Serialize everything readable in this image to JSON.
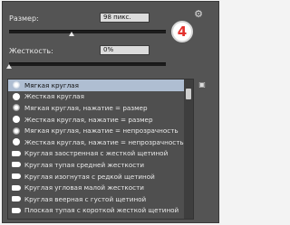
{
  "size": {
    "label": "Размер:",
    "value": "98 пикс.",
    "slider_value": 0.4
  },
  "hardness": {
    "label": "Жесткость:",
    "value": "0%",
    "slider_value": 0.0
  },
  "badge": {
    "text": "4",
    "color": "#e3312d"
  },
  "icons": {
    "settings": "gear-icon",
    "new_preset": "new-preset-icon"
  },
  "presets": [
    {
      "label": "Мягкая круглая",
      "icon": "soft-round",
      "selected": true
    },
    {
      "label": "Жесткая круглая",
      "icon": "hard-round",
      "selected": false
    },
    {
      "label": "Мягкая круглая, нажатие = размер",
      "icon": "soft-round",
      "selected": false
    },
    {
      "label": "Жесткая круглая, нажатие = размер",
      "icon": "hard-round",
      "selected": false
    },
    {
      "label": "Мягкая круглая, нажатие = непрозрачность",
      "icon": "soft-round",
      "selected": false
    },
    {
      "label": "Жесткая круглая, нажатие = непрозрачность",
      "icon": "hard-round",
      "selected": false
    },
    {
      "label": "Круглая заостренная с жесткой щетиной",
      "icon": "bristle-tip",
      "selected": false
    },
    {
      "label": "Круглая тупая средней жесткости",
      "icon": "bristle-tip",
      "selected": false
    },
    {
      "label": "Круглая изогнутая с редкой щетиной",
      "icon": "bristle-tip",
      "selected": false
    },
    {
      "label": "Круглая угловая малой жесткости",
      "icon": "bristle-tip",
      "selected": false
    },
    {
      "label": "Круглая веерная с густой щетиной",
      "icon": "bristle-tip",
      "selected": false
    },
    {
      "label": "Плоская тупая с короткой жесткой щетиной",
      "icon": "bristle-tip",
      "selected": false
    }
  ],
  "scrollbar": {
    "position": 0.05
  }
}
